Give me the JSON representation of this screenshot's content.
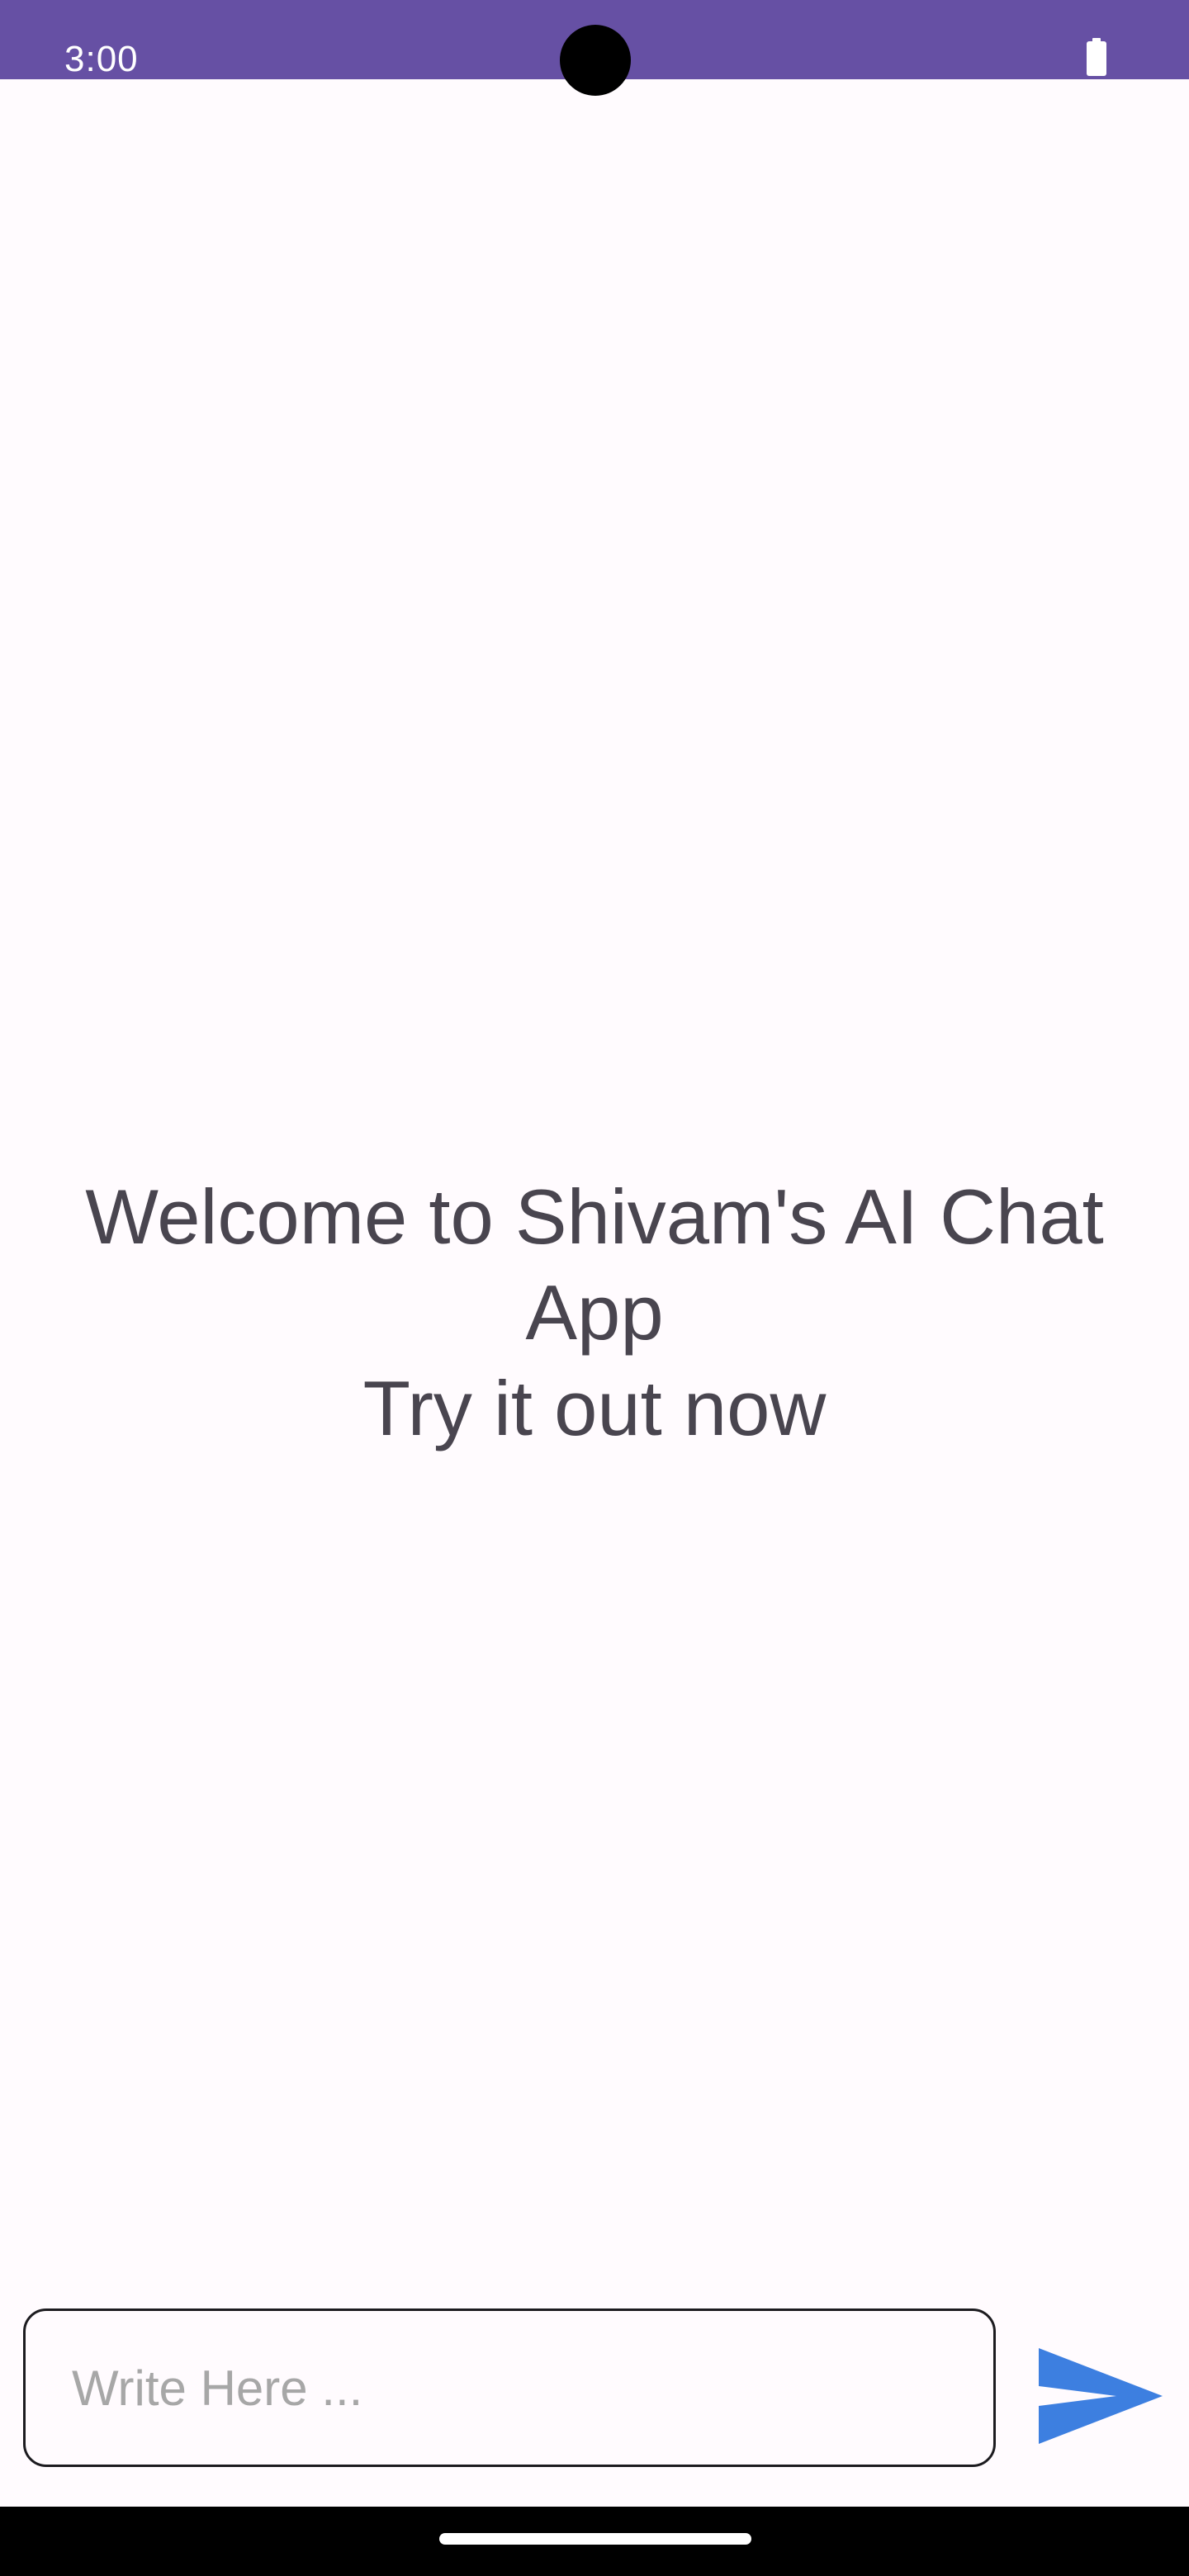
{
  "status_bar": {
    "time": "3:00",
    "battery_icon": "battery-full-icon",
    "color": "#6650a4"
  },
  "welcome": {
    "line1": "Welcome to Shivam's AI Chat",
    "line2": "App",
    "line3": "Try it out now",
    "color": "#49454f"
  },
  "chat_input": {
    "placeholder": "Write Here ...",
    "value": ""
  },
  "send_button": {
    "icon": "send-icon",
    "color": "#3d7fe0"
  },
  "navigation": {
    "home_indicator": "home-indicator"
  }
}
